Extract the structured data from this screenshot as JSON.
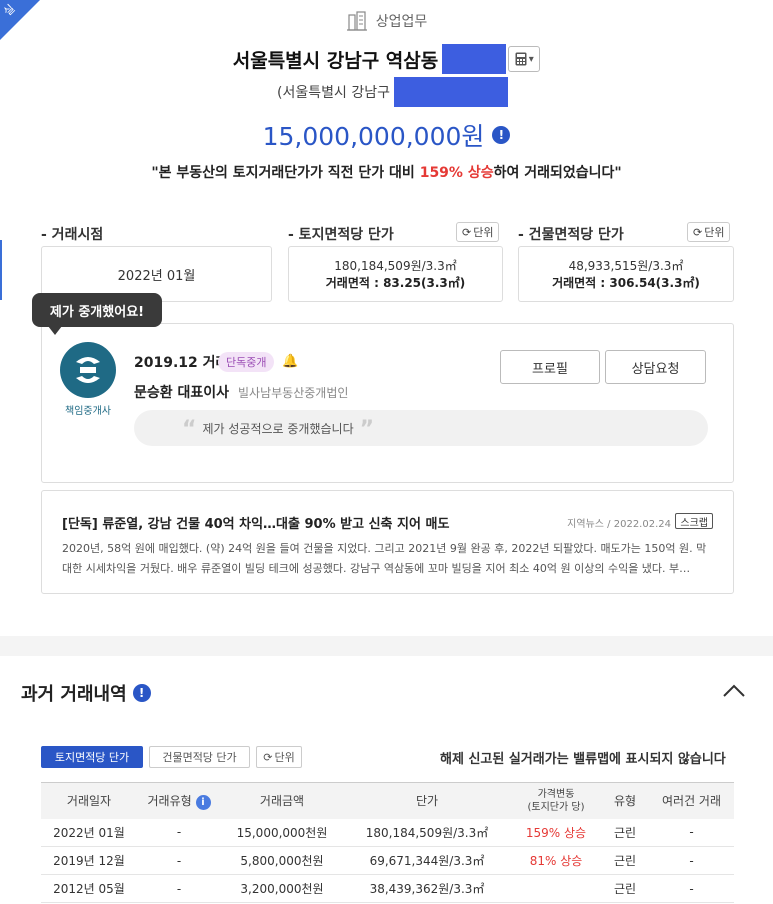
{
  "corner_tag": {
    "label": "실"
  },
  "header": {
    "property_type": "상업업무",
    "address_main": "서울특별시 강남구 역삼동",
    "address_sub": "(서울특별시 강남구",
    "price": "15,000,000,000원",
    "quote_prefix": "\"본 부동산의 토지거래단가가 직전 단가 대비 ",
    "quote_highlight": "159% 상승",
    "quote_suffix": "하여 거래되었습니다\""
  },
  "stats": {
    "unit_label": "단위",
    "deal_time": {
      "label": "- 거래시점",
      "value": "2022년 01월"
    },
    "land_unit_price": {
      "label": "- 토지면적당 단가",
      "value": "180,184,509원/3.3㎡",
      "area": "거래면적 : 83.25(3.3㎡)"
    },
    "building_unit_price": {
      "label": "- 건물면적당 단가",
      "value": "48,933,515원/3.3㎡",
      "area": "거래면적 : 306.54(3.3㎡)"
    }
  },
  "agent": {
    "bubble": "제가 중개했어요!",
    "logo_caption": "책임중개사",
    "deal_date": "2019.12 거래",
    "badge": "단독중개",
    "name": "문승환 대표이사",
    "office": "빌사남부동산중개법인",
    "comment": "제가 성공적으로 중개했습니다",
    "profile_button": "프로필",
    "consult_button": "상담요청"
  },
  "news": {
    "title": "[단독] 류준열, 강남 건물 40억 차익…대출 90% 받고 신축 지어 매도",
    "source": "지역뉴스",
    "date": "2022.02.24",
    "scrap": "스크랩",
    "body": "2020년, 58억 원에 매입했다. (약) 24억 원을 들여 건물을 지었다. 그리고 2021년 9월 완공 후, 2022년 되팔았다. 매도가는 150억 원. 막대한 시세차익을 거뒀다. 배우 류준열이 빌딩 테크에 성공했다. 강남구 역삼동에 꼬마 빌딩을 지어 최소 40억 원 이상의 수익을 냈다. 부…"
  },
  "history": {
    "title": "과거 거래내역",
    "tab_land": "토지면적당 단가",
    "tab_building": "건물면적당 단가",
    "unit_label": "단위",
    "note": "해제 신고된 실거래가는 밸류맵에 표시되지 않습니다",
    "columns": [
      "거래일자",
      "거래유형",
      "거래금액",
      "단가",
      "가격변동",
      "(토지단가 당)",
      "유형",
      "여러건 거래"
    ],
    "rows": [
      {
        "date": "2022년 01월",
        "type": "-",
        "amount": "15,000,000천원",
        "unit_price": "180,184,509원/3.3㎡",
        "change": "159% 상승",
        "category": "근린",
        "multi": "-"
      },
      {
        "date": "2019년 12월",
        "type": "-",
        "amount": "5,800,000천원",
        "unit_price": "69,671,344원/3.3㎡",
        "change": "81% 상승",
        "category": "근린",
        "multi": "-"
      },
      {
        "date": "2012년 05월",
        "type": "-",
        "amount": "3,200,000천원",
        "unit_price": "38,439,362원/3.3㎡",
        "change": "",
        "category": "근린",
        "multi": "-"
      }
    ]
  },
  "colors": {
    "accent": "#2a56c6",
    "redaction": "#3d5ee0",
    "rise": "#e53935",
    "badge_bg": "#f3e3f7",
    "badge_text": "#9b4db5"
  }
}
